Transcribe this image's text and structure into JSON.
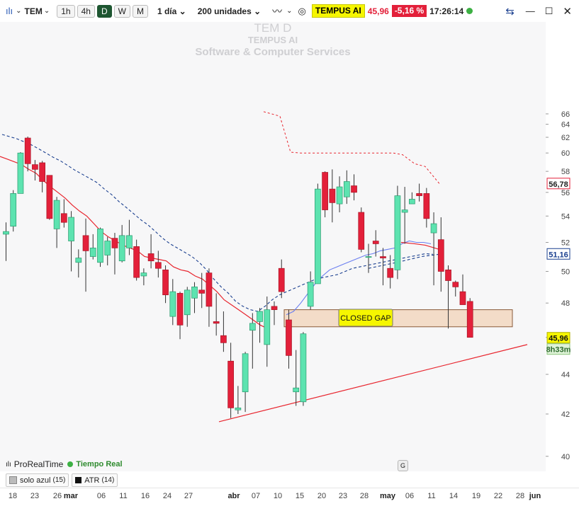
{
  "toolbar": {
    "symbol": "TEM",
    "timeframes": [
      "1h",
      "4h",
      "D",
      "W",
      "M"
    ],
    "active_timeframe": "D",
    "period": "1 día",
    "units": "200 unidades",
    "instrument_label": "TEMPUS AI",
    "price": "45,96",
    "change": "-5,16 %",
    "time": "17:26:14"
  },
  "watermark": {
    "ticker": "TEM  D",
    "name": "TEMPUS AI",
    "sector": "Software & Computer Services"
  },
  "footer": {
    "brand": "ProRealTime",
    "realtime": "Tiempo Real",
    "indicators": [
      {
        "label": "solo azul",
        "param": "(15)"
      },
      {
        "label": "ATR",
        "param": "(14)"
      }
    ]
  },
  "annotation": {
    "label": "CLOSED GAP"
  },
  "event_marker": "G",
  "price_tags": {
    "dashed_red": "56,78",
    "blue_ma": "51,16",
    "last_price": "45,96",
    "countdown": "8h33m"
  },
  "colors": {
    "bull": "#5de3b0",
    "bear": "#e3203a",
    "red_ma": "#e8252e",
    "blue_ma": "#1a3f8f",
    "light_blue": "#6a7ef0",
    "gap_fill": "#f3dcc8",
    "label_bg": "#f6f600"
  },
  "chart_data": {
    "type": "candlestick",
    "x_ticks": [
      "18",
      "23",
      "26 mar",
      "06",
      "11",
      "16",
      "24",
      "27",
      "abr",
      "07",
      "10",
      "15",
      "20",
      "23",
      "28",
      "may",
      "06",
      "11",
      "14",
      "19",
      "22",
      "28 jun"
    ],
    "y_ticks": [
      40,
      42,
      44,
      46,
      48,
      50,
      52,
      54,
      56,
      58,
      60,
      62,
      64,
      66
    ],
    "ylim": [
      39,
      67
    ],
    "candles": [
      [
        52.6,
        53.5,
        50.7,
        52.8
      ],
      [
        53.2,
        56.2,
        52.8,
        55.9
      ],
      [
        55.9,
        60.1,
        57.0,
        60.0
      ],
      [
        61.9,
        62.1,
        58.0,
        58.8
      ],
      [
        58.7,
        59.2,
        57.1,
        58.2
      ],
      [
        58.9,
        59.1,
        56.0,
        57.0
      ],
      [
        57.6,
        57.6,
        53.7,
        53.8
      ],
      [
        53.0,
        55.6,
        51.6,
        55.3
      ],
      [
        54.2,
        55.4,
        53.1,
        53.5
      ],
      [
        52.1,
        54.4,
        50.0,
        53.9
      ],
      [
        50.6,
        51.5,
        49.6,
        50.9
      ],
      [
        52.5,
        53.8,
        48.7,
        51.4
      ],
      [
        51.0,
        52.6,
        50.8,
        51.6
      ],
      [
        50.6,
        53.1,
        50.3,
        53.0
      ],
      [
        51.1,
        52.4,
        50.4,
        52.1
      ],
      [
        52.3,
        52.7,
        49.8,
        51.6
      ],
      [
        50.7,
        53.3,
        50.6,
        52.5
      ],
      [
        51.6,
        53.7,
        51.1,
        52.5
      ],
      [
        51.7,
        52.2,
        49.4,
        49.6
      ],
      [
        49.7,
        50.2,
        49.1,
        49.9
      ],
      [
        51.2,
        52.6,
        50.2,
        50.7
      ],
      [
        50.6,
        51.4,
        49.6,
        50.2
      ],
      [
        50.1,
        50.4,
        48.0,
        48.5
      ],
      [
        47.2,
        49.5,
        46.7,
        48.7
      ],
      [
        48.6,
        48.7,
        45.9,
        46.7
      ],
      [
        47.3,
        49.0,
        46.6,
        48.8
      ],
      [
        48.3,
        49.3,
        47.4,
        49.0
      ],
      [
        48.8,
        49.9,
        47.7,
        48.6
      ],
      [
        49.9,
        50.2,
        46.6,
        47.8
      ],
      [
        46.9,
        48.6,
        46.1,
        46.8
      ],
      [
        46.1,
        47.5,
        45.2,
        45.7
      ],
      [
        44.7,
        45.7,
        41.8,
        42.3
      ],
      [
        42.2,
        43.4,
        42.0,
        42.3
      ],
      [
        43.1,
        45.2,
        42.1,
        45.1
      ],
      [
        46.4,
        47.4,
        44.3,
        46.8
      ],
      [
        46.9,
        47.7,
        45.7,
        47.5
      ],
      [
        45.6,
        48.4,
        44.4,
        47.6
      ],
      [
        47.8,
        48.1,
        46.7,
        47.6
      ],
      [
        50.2,
        50.8,
        48.3,
        48.7
      ],
      [
        47.0,
        47.6,
        44.3,
        45.0
      ],
      [
        43.1,
        45.3,
        42.4,
        43.3
      ],
      [
        42.6,
        46.3,
        42.4,
        46.2
      ],
      [
        47.8,
        50.0,
        47.6,
        49.3
      ],
      [
        49.2,
        56.8,
        49.2,
        56.3
      ],
      [
        57.9,
        58.0,
        53.9,
        54.5
      ],
      [
        56.3,
        58.2,
        53.5,
        55.1
      ],
      [
        55.0,
        57.5,
        54.3,
        56.5
      ],
      [
        55.6,
        58.1,
        55.0,
        57.0
      ],
      [
        56.6,
        57.7,
        55.3,
        56.0
      ],
      [
        54.3,
        54.7,
        51.3,
        51.5
      ],
      [
        51.0,
        51.9,
        49.9,
        51.0
      ],
      [
        52.1,
        52.9,
        51.0,
        51.9
      ],
      [
        51.0,
        51.6,
        49.1,
        50.9
      ],
      [
        50.2,
        51.1,
        48.9,
        49.6
      ],
      [
        50.1,
        56.6,
        49.5,
        55.7
      ],
      [
        54.3,
        56.5,
        51.9,
        54.5
      ],
      [
        55.0,
        56.0,
        55.0,
        55.4
      ],
      [
        55.9,
        56.8,
        55.2,
        55.7
      ],
      [
        55.9,
        56.4,
        53.1,
        53.8
      ],
      [
        52.7,
        54.3,
        49.1,
        53.4
      ],
      [
        52.2,
        53.9,
        48.7,
        50.0
      ],
      [
        50.1,
        50.4,
        46.5,
        49.4
      ],
      [
        49.3,
        49.4,
        48.4,
        49.0
      ],
      [
        48.7,
        49.8,
        48.4,
        47.9
      ],
      [
        48.1,
        48.3,
        46.1,
        46.0
      ]
    ],
    "red_ma": [
      59.6,
      59.3,
      59.0,
      58.7,
      58.2,
      57.8,
      57.1,
      56.5,
      56.0,
      55.5,
      54.9,
      54.4,
      54.0,
      53.4,
      52.8,
      52.4,
      52.1,
      51.8,
      51.6,
      51.4,
      51.0,
      50.9,
      50.8,
      50.7,
      50.3,
      50.1,
      50.0,
      49.7,
      49.5,
      49.1,
      48.7,
      48.2,
      47.9,
      47.6,
      47.3,
      47.0,
      46.7,
      46.5
    ],
    "blue_ma": [
      62.4,
      62.1,
      61.8,
      61.4,
      61.0,
      60.5,
      60.0,
      59.5,
      59.1,
      58.6,
      58.1,
      57.7,
      57.3,
      56.9,
      56.3,
      55.8,
      55.2,
      54.7,
      54.2,
      53.7,
      53.3,
      52.8,
      52.3,
      51.9,
      51.6,
      51.3,
      51.0,
      50.6,
      50.1,
      49.5,
      49.0,
      48.6,
      48.1,
      47.8,
      47.6,
      47.5,
      47.8,
      48.2,
      48.5,
      48.7,
      48.9,
      49.1,
      49.3,
      49.5,
      49.6,
      49.7,
      49.8,
      50.0,
      50.2,
      50.3,
      50.4,
      50.5,
      50.6,
      50.7,
      50.8,
      50.9,
      51.0,
      51.1,
      51.2,
      51.16
    ],
    "light_blue_ma": [
      47.3,
      47.5,
      48.0,
      48.6,
      49.2,
      49.7,
      50.1,
      50.3,
      50.5,
      50.7,
      50.9,
      51.1,
      51.2,
      51.4,
      51.5,
      51.6,
      51.9,
      52.1,
      52.0,
      52.0,
      51.9
    ],
    "dashed_red_levels": [
      66.5,
      65.5,
      60.1,
      60.0,
      60.0,
      60.0,
      59.8,
      58.8,
      58.5,
      56.8
    ],
    "closed_gap_zone": [
      46.6,
      47.6
    ],
    "trendline": [
      [
        41.9,
        0
      ],
      [
        45.6,
        1
      ]
    ]
  }
}
